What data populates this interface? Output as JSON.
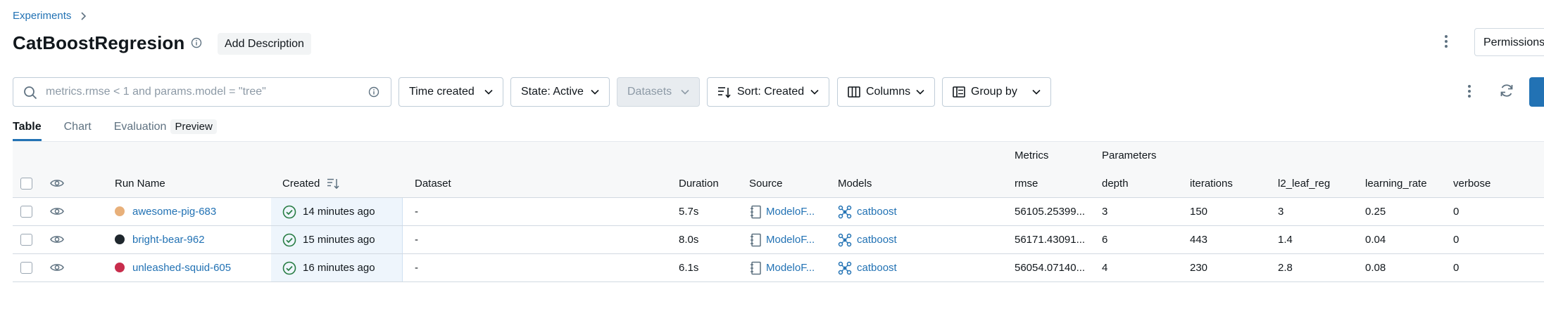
{
  "breadcrumb": {
    "experiments": "Experiments"
  },
  "header": {
    "title": "CatBoostRegresion",
    "add_description": "Add Description",
    "permissions": "Permissions"
  },
  "toolbar": {
    "search_placeholder": "metrics.rmse < 1 and params.model = \"tree\"",
    "time_created": "Time created",
    "state": "State: Active",
    "datasets": "Datasets",
    "sort": "Sort: Created",
    "columns": "Columns",
    "group_by": "Group by"
  },
  "tabs": {
    "table": "Table",
    "chart": "Chart",
    "evaluation": "Evaluation",
    "preview": "Preview"
  },
  "table": {
    "groups": {
      "metrics": "Metrics",
      "parameters": "Parameters"
    },
    "headers": {
      "run_name": "Run Name",
      "created": "Created",
      "dataset": "Dataset",
      "duration": "Duration",
      "source": "Source",
      "models": "Models",
      "rmse": "rmse",
      "depth": "depth",
      "iterations": "iterations",
      "l2_leaf_reg": "l2_leaf_reg",
      "learning_rate": "learning_rate",
      "verbose": "verbose"
    },
    "rows": [
      {
        "color": "#e8b07a",
        "run_name": "awesome-pig-683",
        "created": "14 minutes ago",
        "dataset": "-",
        "duration": "5.7s",
        "source": "ModeloF...",
        "model": "catboost",
        "rmse": "56105.25399...",
        "depth": "3",
        "iterations": "150",
        "l2_leaf_reg": "3",
        "learning_rate": "0.25",
        "verbose": "0"
      },
      {
        "color": "#1f272d",
        "run_name": "bright-bear-962",
        "created": "15 minutes ago",
        "dataset": "-",
        "duration": "8.0s",
        "source": "ModeloF...",
        "model": "catboost",
        "rmse": "56171.43091...",
        "depth": "6",
        "iterations": "443",
        "l2_leaf_reg": "1.4",
        "learning_rate": "0.04",
        "verbose": "0"
      },
      {
        "color": "#c82d4c",
        "run_name": "unleashed-squid-605",
        "created": "16 minutes ago",
        "dataset": "-",
        "duration": "6.1s",
        "source": "ModeloF...",
        "model": "catboost",
        "rmse": "56054.07140...",
        "depth": "4",
        "iterations": "230",
        "l2_leaf_reg": "2.8",
        "learning_rate": "0.08",
        "verbose": "0"
      }
    ]
  }
}
